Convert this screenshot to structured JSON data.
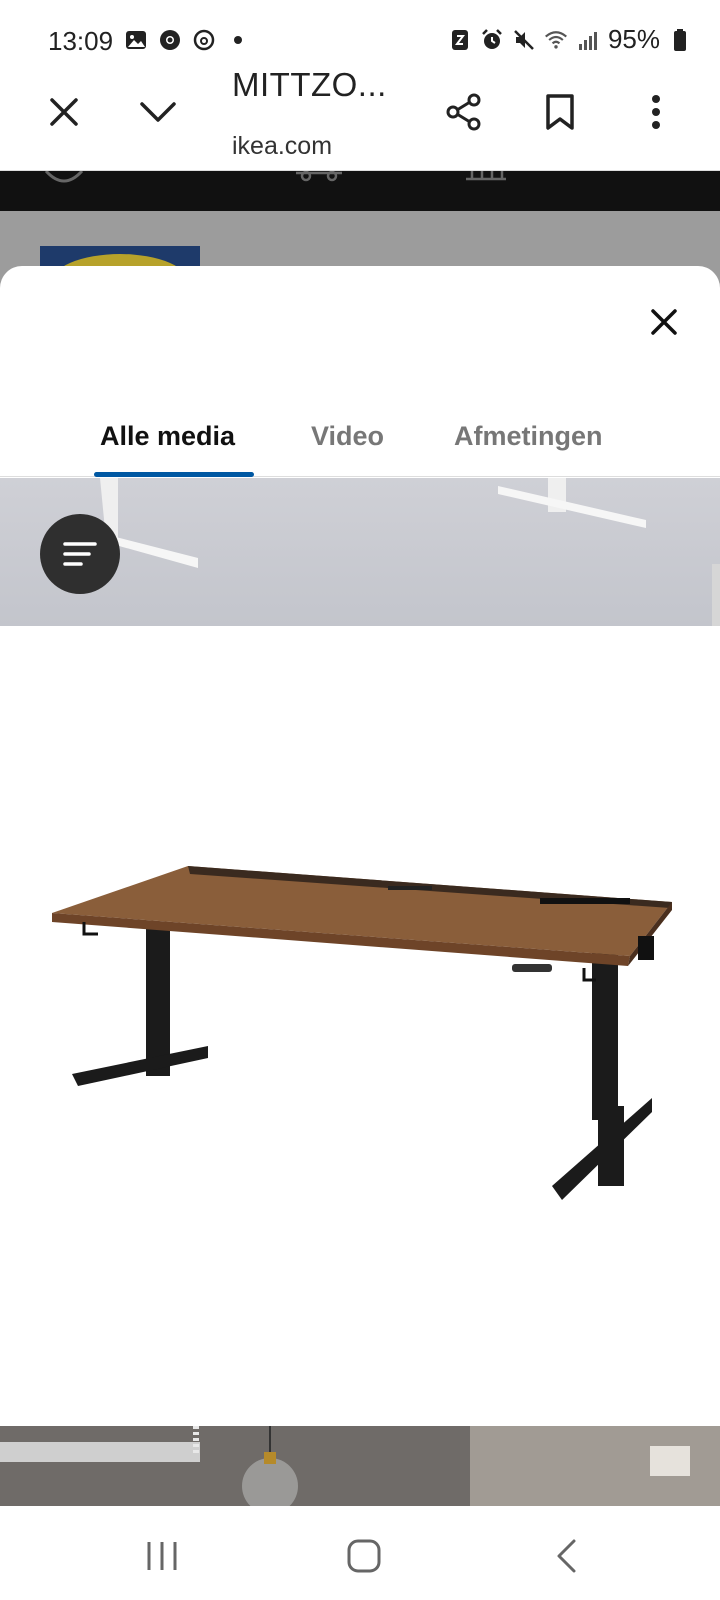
{
  "status_bar": {
    "time": "13:09",
    "battery": "95%",
    "left_icons": [
      "gallery-icon",
      "chrome-icon",
      "threads-icon",
      "dot-icon"
    ],
    "right_icons": [
      "nfc-icon",
      "alarm-icon",
      "mute-icon",
      "wifi-icon",
      "signal-icon",
      "battery-icon"
    ]
  },
  "toolbar": {
    "title": "MITTZO...",
    "domain": "ikea.com",
    "icons": [
      "close-icon",
      "chevron-down-icon",
      "share-icon",
      "bookmark-icon",
      "more-vert-icon"
    ]
  },
  "media_sheet": {
    "tabs": [
      {
        "label": "Alle media",
        "active": true
      },
      {
        "label": "Video",
        "active": false
      },
      {
        "label": "Afmetingen",
        "active": false
      }
    ],
    "accent_color": "#0058a3",
    "filter_icon": "filter-list-icon",
    "image_subject": "desk with walnut top and black legs"
  },
  "nav_bar": {
    "icons": [
      "recents-icon",
      "home-icon",
      "back-icon"
    ]
  }
}
